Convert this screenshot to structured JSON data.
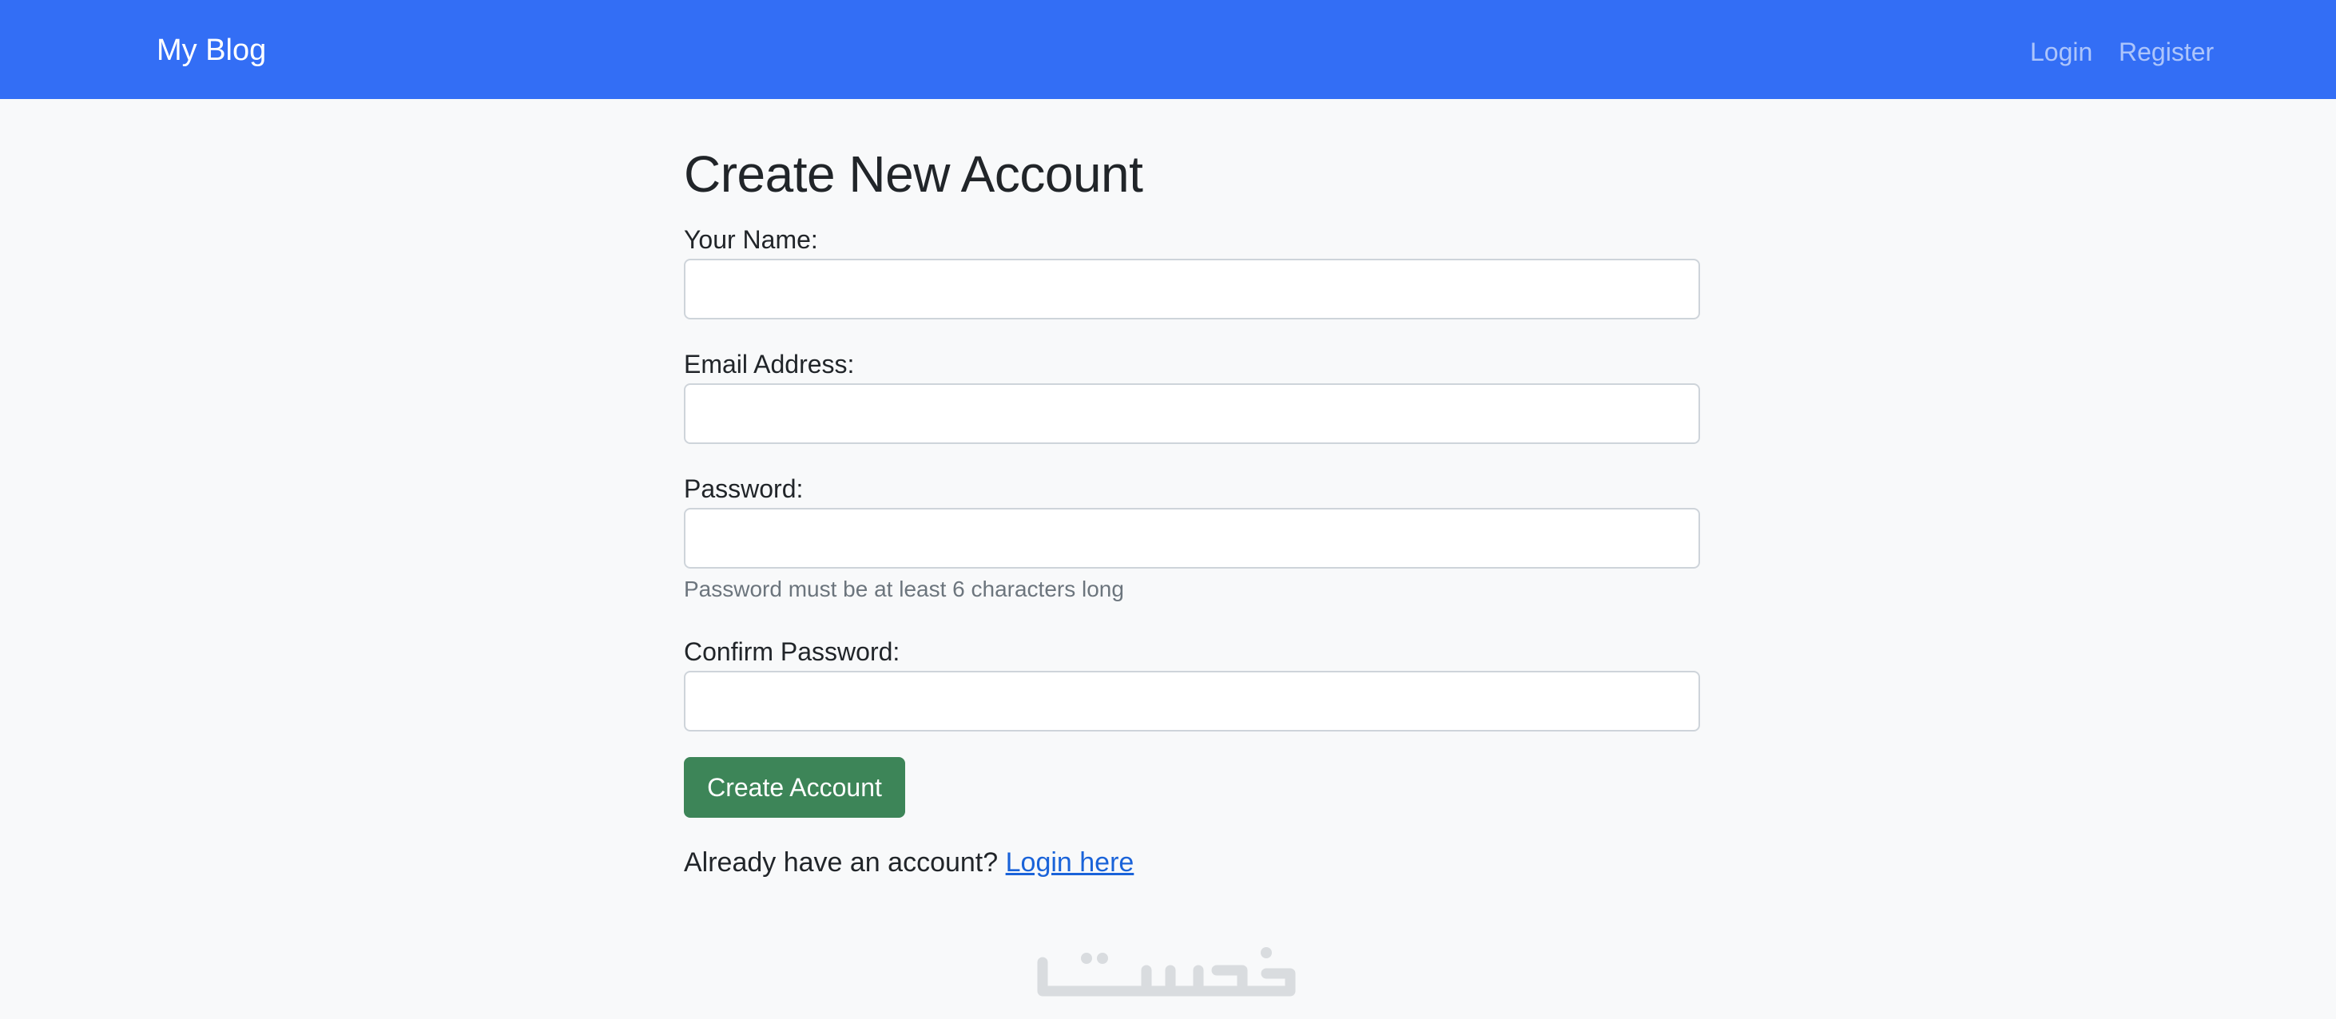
{
  "navbar": {
    "brand": "My Blog",
    "links": {
      "login": "Login",
      "register": "Register"
    },
    "colors": {
      "background": "#336ef5"
    }
  },
  "form": {
    "title": "Create New Account",
    "fields": {
      "name": {
        "label": "Your Name:",
        "value": ""
      },
      "email": {
        "label": "Email Address:",
        "value": ""
      },
      "password": {
        "label": "Password:",
        "value": "",
        "help": "Password must be at least 6 characters long"
      },
      "confirm_password": {
        "label": "Confirm Password:",
        "value": ""
      }
    },
    "submit_label": "Create Account",
    "submit_color": "#3d8558"
  },
  "footer_prompt": {
    "text": "Already have an account?",
    "link_label": "Login here"
  },
  "watermark": {
    "icon": "watermark-logo-icon"
  }
}
